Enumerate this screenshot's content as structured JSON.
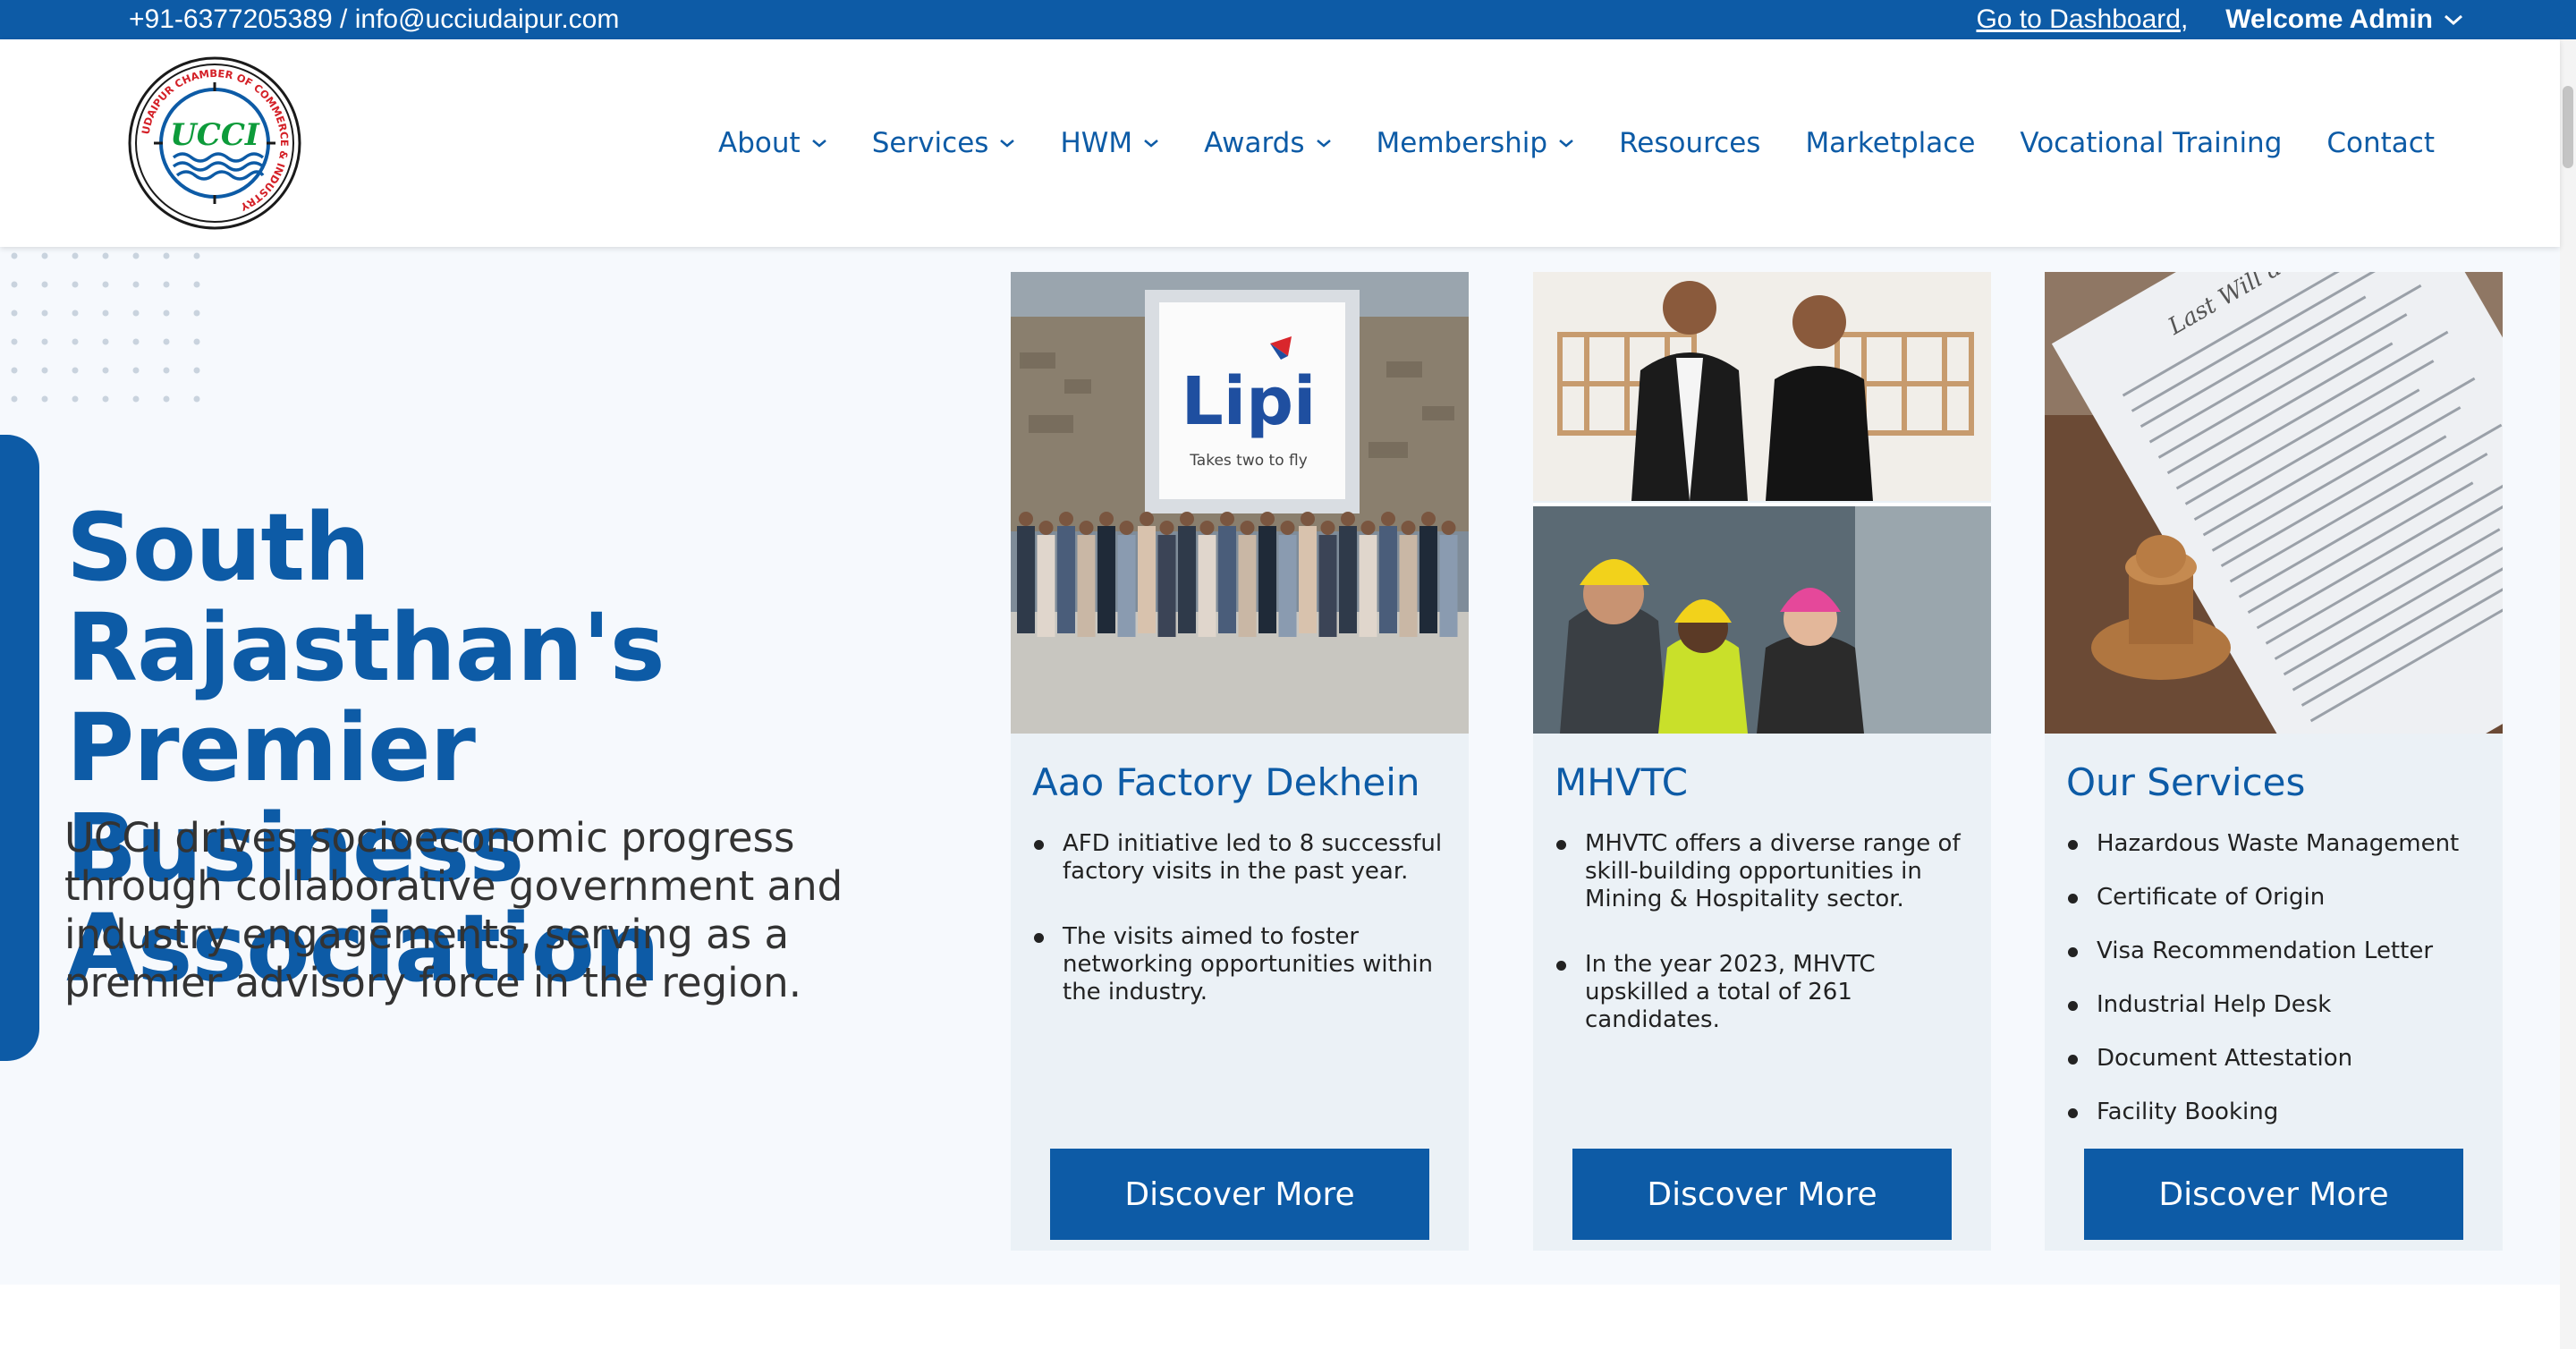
{
  "topbar": {
    "contact": "+91-6377205389 / info@ucciudaipur.com",
    "dashboard_link": "Go to Dashboard",
    "separator": ",",
    "welcome": "Welcome Admin"
  },
  "logo": {
    "text": "UCCI",
    "ring_text": "UDAIPUR CHAMBER OF COMMERCE & INDUSTRY"
  },
  "nav": {
    "items": [
      {
        "label": "About",
        "dropdown": true
      },
      {
        "label": "Services",
        "dropdown": true
      },
      {
        "label": "HWM",
        "dropdown": true
      },
      {
        "label": "Awards",
        "dropdown": true
      },
      {
        "label": "Membership",
        "dropdown": true
      },
      {
        "label": "Resources",
        "dropdown": false
      },
      {
        "label": "Marketplace",
        "dropdown": false
      },
      {
        "label": "Vocational Training",
        "dropdown": false
      },
      {
        "label": "Contact",
        "dropdown": false
      }
    ]
  },
  "hero": {
    "title": "South Rajasthan's Premier Business Association",
    "subtitle": "UCCI drives socioeconomic progress through collaborative government and industry engagements, serving as a premier advisory force in the region."
  },
  "cards": [
    {
      "title": "Aao Factory Dekhein",
      "image_sign": "Lipi",
      "image_tagline": "Takes two to fly",
      "bullets": [
        "AFD initiative led to 8 successful factory visits in the past year.",
        "The visits aimed to foster networking opportunities within the industry."
      ],
      "button": "Discover More"
    },
    {
      "title": "MHVTC",
      "bullets": [
        "MHVTC offers a diverse range of skill-building opportunities in Mining & Hospitality sector.",
        "In the year 2023, MHVTC upskilled a total of 261 candidates."
      ],
      "button": "Discover More"
    },
    {
      "title": "Our Services",
      "image_doc_heading": "Last Will and",
      "bullets": [
        "Hazardous Waste Management",
        "Certificate of Origin",
        "Visa Recommendation Letter",
        "Industrial Help Desk",
        "Document Attestation",
        "Facility Booking"
      ],
      "button": "Discover More"
    }
  ],
  "colors": {
    "brand_blue": "#0d5ba6",
    "hero_bg": "#f6f9fd",
    "card_bg": "#ebf1f6"
  }
}
